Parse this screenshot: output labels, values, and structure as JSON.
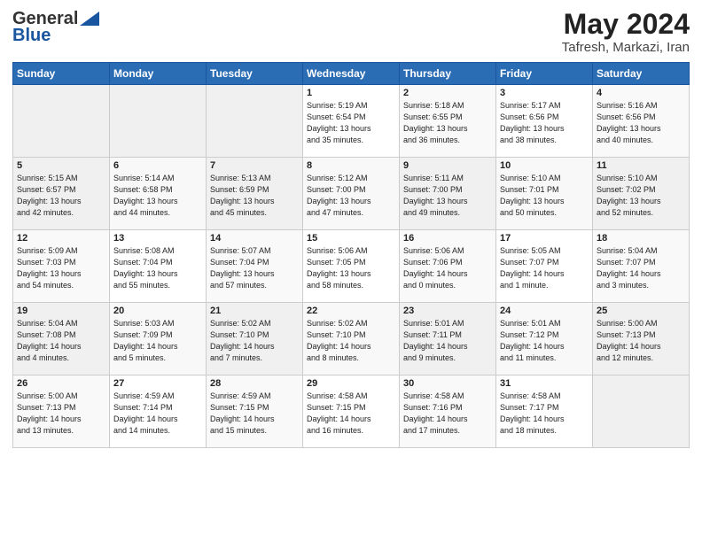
{
  "header": {
    "logo_general": "General",
    "logo_blue": "Blue",
    "title": "May 2024",
    "location": "Tafresh, Markazi, Iran"
  },
  "days_of_week": [
    "Sunday",
    "Monday",
    "Tuesday",
    "Wednesday",
    "Thursday",
    "Friday",
    "Saturday"
  ],
  "weeks": [
    [
      {
        "day": "",
        "info": ""
      },
      {
        "day": "",
        "info": ""
      },
      {
        "day": "",
        "info": ""
      },
      {
        "day": "1",
        "info": "Sunrise: 5:19 AM\nSunset: 6:54 PM\nDaylight: 13 hours\nand 35 minutes."
      },
      {
        "day": "2",
        "info": "Sunrise: 5:18 AM\nSunset: 6:55 PM\nDaylight: 13 hours\nand 36 minutes."
      },
      {
        "day": "3",
        "info": "Sunrise: 5:17 AM\nSunset: 6:56 PM\nDaylight: 13 hours\nand 38 minutes."
      },
      {
        "day": "4",
        "info": "Sunrise: 5:16 AM\nSunset: 6:56 PM\nDaylight: 13 hours\nand 40 minutes."
      }
    ],
    [
      {
        "day": "5",
        "info": "Sunrise: 5:15 AM\nSunset: 6:57 PM\nDaylight: 13 hours\nand 42 minutes."
      },
      {
        "day": "6",
        "info": "Sunrise: 5:14 AM\nSunset: 6:58 PM\nDaylight: 13 hours\nand 44 minutes."
      },
      {
        "day": "7",
        "info": "Sunrise: 5:13 AM\nSunset: 6:59 PM\nDaylight: 13 hours\nand 45 minutes."
      },
      {
        "day": "8",
        "info": "Sunrise: 5:12 AM\nSunset: 7:00 PM\nDaylight: 13 hours\nand 47 minutes."
      },
      {
        "day": "9",
        "info": "Sunrise: 5:11 AM\nSunset: 7:00 PM\nDaylight: 13 hours\nand 49 minutes."
      },
      {
        "day": "10",
        "info": "Sunrise: 5:10 AM\nSunset: 7:01 PM\nDaylight: 13 hours\nand 50 minutes."
      },
      {
        "day": "11",
        "info": "Sunrise: 5:10 AM\nSunset: 7:02 PM\nDaylight: 13 hours\nand 52 minutes."
      }
    ],
    [
      {
        "day": "12",
        "info": "Sunrise: 5:09 AM\nSunset: 7:03 PM\nDaylight: 13 hours\nand 54 minutes."
      },
      {
        "day": "13",
        "info": "Sunrise: 5:08 AM\nSunset: 7:04 PM\nDaylight: 13 hours\nand 55 minutes."
      },
      {
        "day": "14",
        "info": "Sunrise: 5:07 AM\nSunset: 7:04 PM\nDaylight: 13 hours\nand 57 minutes."
      },
      {
        "day": "15",
        "info": "Sunrise: 5:06 AM\nSunset: 7:05 PM\nDaylight: 13 hours\nand 58 minutes."
      },
      {
        "day": "16",
        "info": "Sunrise: 5:06 AM\nSunset: 7:06 PM\nDaylight: 14 hours\nand 0 minutes."
      },
      {
        "day": "17",
        "info": "Sunrise: 5:05 AM\nSunset: 7:07 PM\nDaylight: 14 hours\nand 1 minute."
      },
      {
        "day": "18",
        "info": "Sunrise: 5:04 AM\nSunset: 7:07 PM\nDaylight: 14 hours\nand 3 minutes."
      }
    ],
    [
      {
        "day": "19",
        "info": "Sunrise: 5:04 AM\nSunset: 7:08 PM\nDaylight: 14 hours\nand 4 minutes."
      },
      {
        "day": "20",
        "info": "Sunrise: 5:03 AM\nSunset: 7:09 PM\nDaylight: 14 hours\nand 5 minutes."
      },
      {
        "day": "21",
        "info": "Sunrise: 5:02 AM\nSunset: 7:10 PM\nDaylight: 14 hours\nand 7 minutes."
      },
      {
        "day": "22",
        "info": "Sunrise: 5:02 AM\nSunset: 7:10 PM\nDaylight: 14 hours\nand 8 minutes."
      },
      {
        "day": "23",
        "info": "Sunrise: 5:01 AM\nSunset: 7:11 PM\nDaylight: 14 hours\nand 9 minutes."
      },
      {
        "day": "24",
        "info": "Sunrise: 5:01 AM\nSunset: 7:12 PM\nDaylight: 14 hours\nand 11 minutes."
      },
      {
        "day": "25",
        "info": "Sunrise: 5:00 AM\nSunset: 7:13 PM\nDaylight: 14 hours\nand 12 minutes."
      }
    ],
    [
      {
        "day": "26",
        "info": "Sunrise: 5:00 AM\nSunset: 7:13 PM\nDaylight: 14 hours\nand 13 minutes."
      },
      {
        "day": "27",
        "info": "Sunrise: 4:59 AM\nSunset: 7:14 PM\nDaylight: 14 hours\nand 14 minutes."
      },
      {
        "day": "28",
        "info": "Sunrise: 4:59 AM\nSunset: 7:15 PM\nDaylight: 14 hours\nand 15 minutes."
      },
      {
        "day": "29",
        "info": "Sunrise: 4:58 AM\nSunset: 7:15 PM\nDaylight: 14 hours\nand 16 minutes."
      },
      {
        "day": "30",
        "info": "Sunrise: 4:58 AM\nSunset: 7:16 PM\nDaylight: 14 hours\nand 17 minutes."
      },
      {
        "day": "31",
        "info": "Sunrise: 4:58 AM\nSunset: 7:17 PM\nDaylight: 14 hours\nand 18 minutes."
      },
      {
        "day": "",
        "info": ""
      }
    ]
  ]
}
